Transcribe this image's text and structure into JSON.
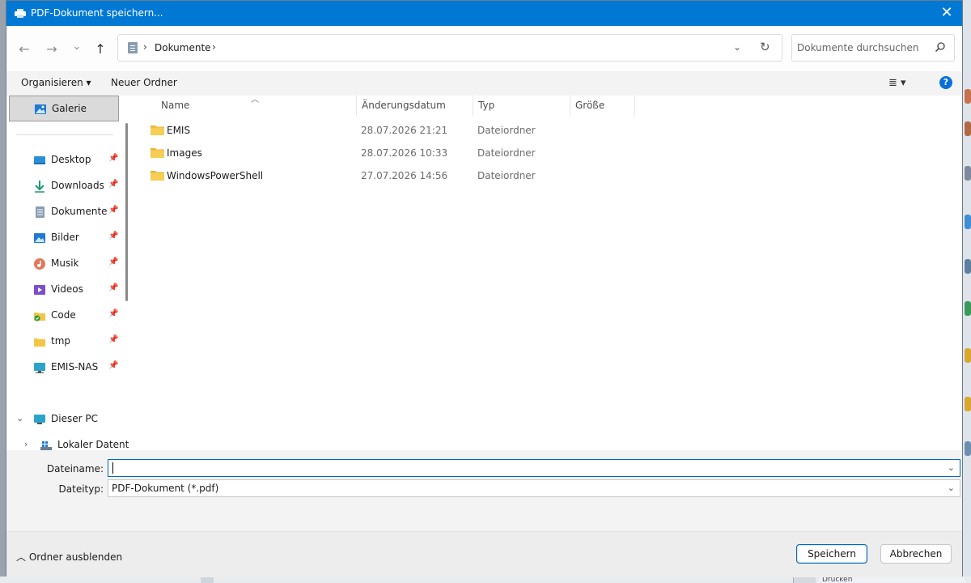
{
  "window": {
    "title": "PDF-Dokument speichern...",
    "close_glyph": "✕"
  },
  "nav": {
    "back_glyph": "←",
    "forward_glyph": "→",
    "recent_glyph": "⌄",
    "up_glyph": "↑",
    "breadcrumb": [
      "Dokumente"
    ],
    "search_placeholder": "Dokumente durchsuchen"
  },
  "toolbar": {
    "organize_label": "Organisieren ▾",
    "new_folder_label": "Neuer Ordner",
    "view_glyph": "≣ ▾",
    "help_glyph": "?"
  },
  "sidebar": {
    "gallery": "Galerie",
    "quick_access": [
      {
        "label": "Desktop",
        "icon": "desktop-icon"
      },
      {
        "label": "Downloads",
        "icon": "download-icon"
      },
      {
        "label": "Dokumente",
        "icon": "documents-icon"
      },
      {
        "label": "Bilder",
        "icon": "pictures-icon"
      },
      {
        "label": "Musik",
        "icon": "music-icon"
      },
      {
        "label": "Videos",
        "icon": "videos-icon"
      },
      {
        "label": "Code",
        "icon": "folder-icon"
      },
      {
        "label": "tmp",
        "icon": "folder-icon"
      },
      {
        "label": "EMIS-NAS",
        "icon": "network-drive-icon"
      }
    ],
    "this_pc": "Dieser PC",
    "local_disk": "Lokaler Datent"
  },
  "columns": {
    "name": "Name",
    "modified": "Änderungsdatum",
    "type": "Typ",
    "size": "Größe"
  },
  "files": [
    {
      "name": "EMIS",
      "modified": "28.07.2026 21:21",
      "type": "Dateiordner"
    },
    {
      "name": "Images",
      "modified": "28.07.2026 10:33",
      "type": "Dateiordner"
    },
    {
      "name": "WindowsPowerShell",
      "modified": "27.07.2026 14:56",
      "type": "Dateiordner"
    }
  ],
  "form": {
    "filename_label": "Dateiname:",
    "filename_value": "",
    "filetype_label": "Dateityp:",
    "filetype_value": "PDF-Dokument (*.pdf)"
  },
  "footer": {
    "hide_folders_label": "Ordner ausblenden",
    "save_label": "Speichern",
    "cancel_label": "Abbrechen"
  },
  "background": {
    "partial_text": "Drucken"
  },
  "colors": {
    "accent": "#0078d4",
    "folder": "#f4c646"
  }
}
